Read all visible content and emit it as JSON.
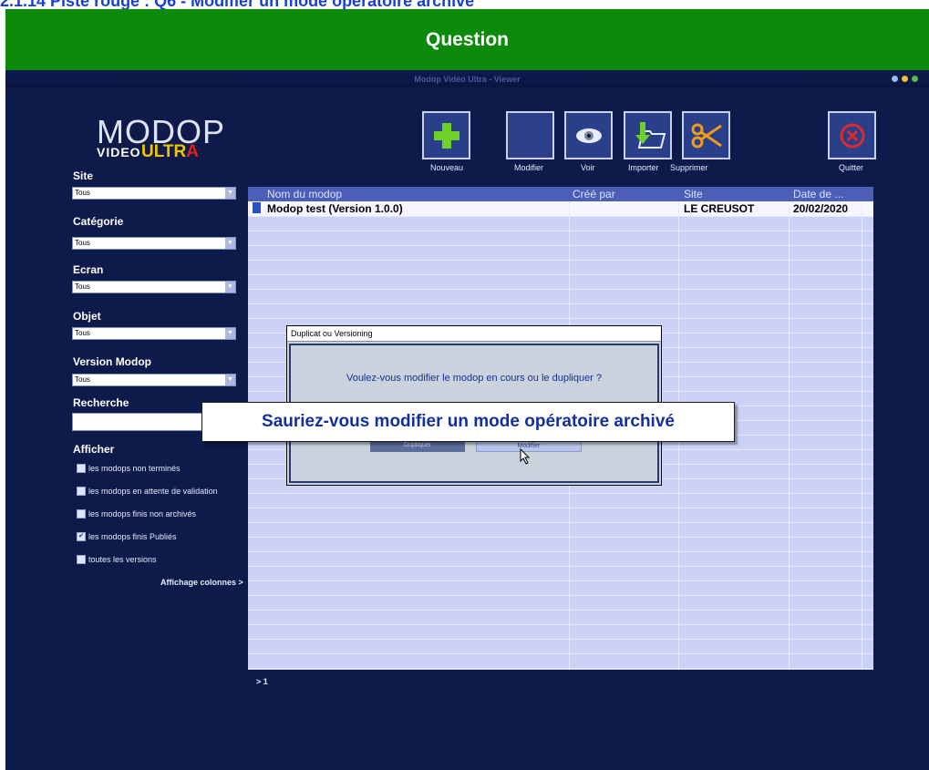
{
  "page_title": "2.1.14 Piste rouge : Q6 - Modifier un mode opératoire archivé",
  "question_header": "Question",
  "app": {
    "window_title": "Modop Vidéo Ultra - Viewer",
    "logo": {
      "modop": "MODOP",
      "video": "VIDEO",
      "ultra_ult": "ULTR",
      "ultra_a": "A"
    },
    "toolbar": {
      "nouveau": "Nouveau",
      "modifier": "Modifier",
      "voir": "Voir",
      "importer": "Importer",
      "supprimer": "Supprimer",
      "quitter": "Quitter"
    },
    "filters": {
      "site": {
        "label": "Site",
        "value": "Tous"
      },
      "categorie": {
        "label": "Catégorie",
        "value": "Tous"
      },
      "ecran": {
        "label": "Ecran",
        "value": "Tous"
      },
      "objet": {
        "label": "Objet",
        "value": "Tous"
      },
      "version": {
        "label": "Version Modop",
        "value": "Tous"
      },
      "recherche": {
        "label": "Recherche",
        "value": ""
      }
    },
    "afficher": {
      "label": "Afficher",
      "options": [
        {
          "label": "les modops non terminés",
          "checked": false
        },
        {
          "label": "les modops en attente de validation",
          "checked": false
        },
        {
          "label": "les modops finis non archivés",
          "checked": false
        },
        {
          "label": "les modops finis Publiés",
          "checked": true
        },
        {
          "label": "toutes les versions",
          "checked": false
        }
      ],
      "columns_link": "Affichage colonnes >"
    },
    "table": {
      "columns": [
        "Nom du modop",
        "Créé par",
        "Site",
        "Date de ..."
      ],
      "rows": [
        {
          "nom": "Modop test (Version 1.0.0)",
          "cree_par": "",
          "site": "LE CREUSOT",
          "date": "20/02/2020"
        }
      ]
    },
    "pager": "> 1"
  },
  "dialog": {
    "title": "Duplicat ou Versioning",
    "question": "Voulez-vous modifier le modop en cours ou le dupliquer ?",
    "btn_dupliquer": "Dupliquer",
    "btn_modifier": "Modifier"
  },
  "banner": "Sauriez-vous modifier un mode opératoire archivé",
  "colors": {
    "question_bar": "#0b8a0b",
    "app_bg": "#0d1a4a",
    "grid_bg": "#ccd2f6",
    "grid_header": "#4a5fb5",
    "title_text": "#1a3fd8"
  }
}
